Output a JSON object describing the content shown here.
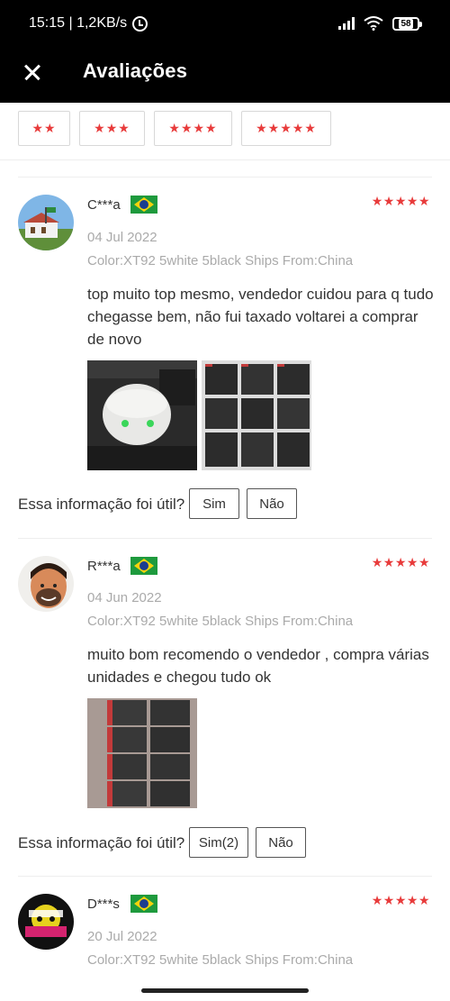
{
  "status_bar": {
    "time_speed": "15:15 | 1,2KB/s",
    "battery": "58",
    "icons": [
      "alarm-icon",
      "signal-icon",
      "wifi-icon",
      "battery-icon"
    ]
  },
  "header": {
    "title": "Avaliações",
    "close_icon": "close-icon"
  },
  "filters": [
    {
      "stars": "★★"
    },
    {
      "stars": "★★★"
    },
    {
      "stars": "★★★★"
    },
    {
      "stars": "★★★★★"
    }
  ],
  "reviews": [
    {
      "name": "C***a",
      "country_flag": "brazil-flag-icon",
      "stars": "★★★★★",
      "date": "04 Jul 2022",
      "sku": "Color:XT92 5white 5black Ships From:China",
      "text": "top muito top mesmo, vendedor cuidou para q tudo chegasse bem, não fui taxado voltarei a comprar de novo",
      "helpful_question": "Essa informação foi útil?",
      "yes_label": "Sim",
      "no_label": "Não"
    },
    {
      "name": "R***a",
      "country_flag": "brazil-flag-icon",
      "stars": "★★★★★",
      "date": "04 Jun 2022",
      "sku": "Color:XT92 5white 5black Ships From:China",
      "text": "muito bom recomendo o vendedor , compra várias unidades e chegou tudo ok",
      "helpful_question": "Essa informação foi útil?",
      "yes_label": "Sim(2)",
      "no_label": "Não"
    },
    {
      "name": "D***s",
      "country_flag": "brazil-flag-icon",
      "stars": "★★★★★",
      "date": "20 Jul 2022",
      "sku": "Color:XT92 5white 5black Ships From:China"
    }
  ],
  "colors": {
    "star_red": "#e83b3b",
    "header_bg": "#000000",
    "muted_text": "#aaaaaa"
  }
}
